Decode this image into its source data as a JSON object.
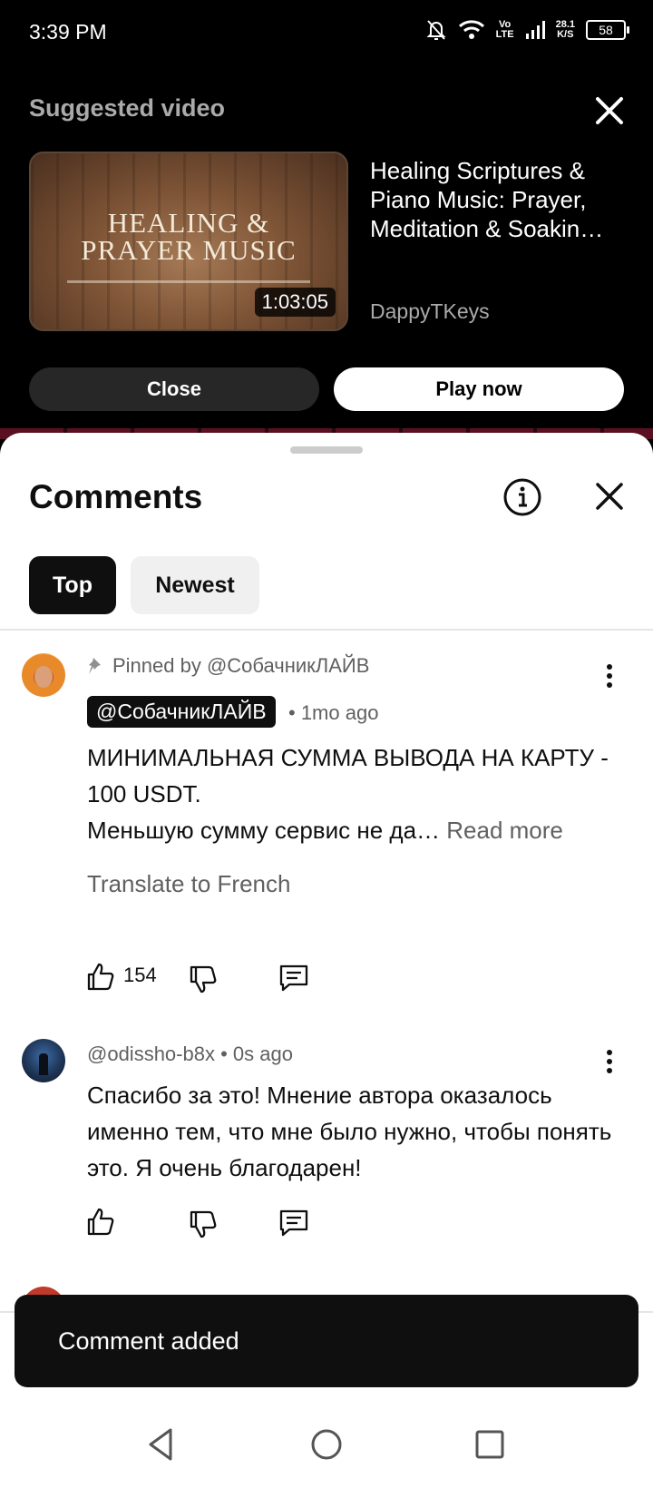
{
  "status_bar": {
    "time": "3:39 PM",
    "volte_top": "Vo",
    "volte_bottom": "LTE",
    "speed_top": "28.1",
    "speed_bottom": "K/S",
    "battery": "58"
  },
  "suggested": {
    "heading": "Suggested video",
    "thumbnail_text": "HEALING &\nPRAYER MUSIC",
    "duration": "1:03:05",
    "title": "Healing Scriptures & Piano Music: Prayer, Meditation & Soakin…",
    "channel": "DappyTKeys",
    "close_label": "Close",
    "play_label": "Play now"
  },
  "comments": {
    "title": "Comments",
    "chips": {
      "top": "Top",
      "newest": "Newest"
    },
    "pinned": {
      "pinned_by": "Pinned by @СобачникЛАЙВ",
      "author": "@СобачникЛАЙВ",
      "age": "• 1mo ago",
      "text_line1": "МИНИМАЛЬНАЯ СУММА ВЫВОДА НА КАРТУ - 100 USDT.",
      "text_line2": "Меньшую сумму сервис не да…",
      "read_more": "Read more",
      "translate": "Translate to French",
      "likes": "154"
    },
    "second": {
      "meta": "@odissho-b8x • 0s ago",
      "text": "Спасибо за это! Мнение автора оказалось именно тем, что мне было нужно, чтобы понять это. Я очень благодарен!"
    }
  },
  "toast": {
    "message": "Comment added"
  },
  "colors": {
    "accent_red": "#5a1020",
    "chip_dark": "#0f0f0f",
    "chip_light": "#f0f0f0"
  }
}
